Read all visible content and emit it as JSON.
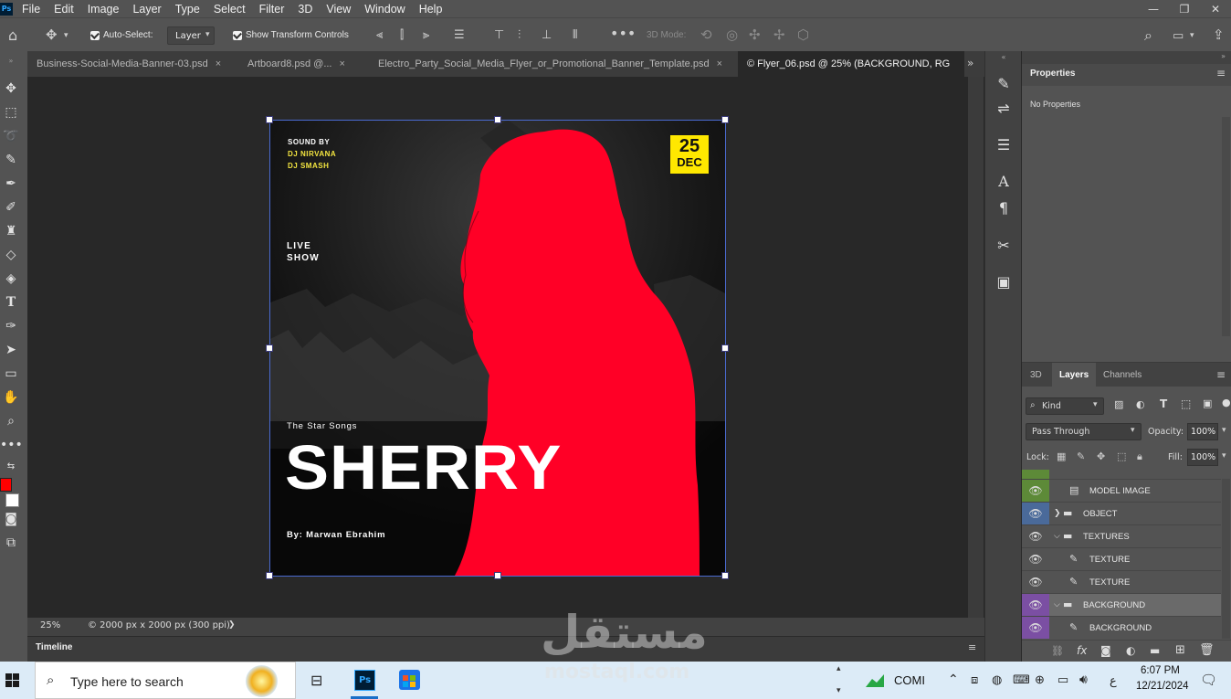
{
  "menu": [
    "File",
    "Edit",
    "Image",
    "Layer",
    "Type",
    "Select",
    "Filter",
    "3D",
    "View",
    "Window",
    "Help"
  ],
  "options": {
    "auto_select_label": "Auto-Select:",
    "auto_select_value": "Layer",
    "transform_label": "Show Transform Controls",
    "mode_3d_label": "3D Mode:"
  },
  "tabs": [
    {
      "label": "Business-Social-Media-Banner-03.psd",
      "close": "×"
    },
    {
      "label": "Artboard8.psd @...",
      "close": "×"
    },
    {
      "label": "Electro_Party_Social_Media_Flyer_or_Promotional_Banner_Template.psd",
      "close": "×"
    },
    {
      "label": "© Flyer_06.psd @ 25% (BACKGROUND, RG"
    }
  ],
  "tabs_more": "»",
  "poster": {
    "sound_by": "SOUND BY",
    "dj1": "DJ NIRVANA",
    "dj2": "DJ SMASH",
    "day": "25",
    "month": "DEC",
    "live": "LIVE",
    "show": "SHOW",
    "star_songs": "The Star Songs",
    "name": "SHERRY",
    "author": "By: Marwan Ebrahim"
  },
  "status": {
    "zoom": "25%",
    "doc_info": "© 2000 px x 2000 px (300 ppi)",
    "arrow": "❯"
  },
  "timeline_label": "Timeline",
  "properties": {
    "title": "Properties",
    "content": "No Properties"
  },
  "layers_panel": {
    "tabs": [
      "3D",
      "Layers",
      "Channels"
    ],
    "filter_kind": "Kind",
    "blend_mode": "Pass Through",
    "opacity_label": "Opacity:",
    "opacity_value": "100%",
    "lock_label": "Lock:",
    "fill_label": "Fill:",
    "fill_value": "100%",
    "rows": [
      {
        "name": "MODEL IMAGE",
        "color": "#5d8a38",
        "indent": 74,
        "icon": "▤"
      },
      {
        "name": "OBJECT",
        "color": "#4a6a9a",
        "indent": 67,
        "icon": "▬"
      },
      {
        "name": "TEXTURES",
        "color": "",
        "indent": 67,
        "icon": "▬"
      },
      {
        "name": "TEXTURE",
        "color": "",
        "indent": 74,
        "icon": "✎"
      },
      {
        "name": "TEXTURE",
        "color": "",
        "indent": 74,
        "icon": "✎"
      },
      {
        "name": "BACKGROUND",
        "color": "#7b4fa3",
        "indent": 67,
        "icon": "▬"
      },
      {
        "name": "BACKGROUND",
        "color": "#7b4fa3",
        "indent": 74,
        "icon": "✎"
      }
    ]
  },
  "taskbar": {
    "search_placeholder": "Type here to search",
    "app_label": "COMI",
    "lang": "ع",
    "time": "6:07 PM",
    "date": "12/21/2024"
  },
  "watermark": {
    "arabic": "مستقل",
    "latin": "mostaql.com"
  },
  "colors": {
    "accent_red": "#ff0026",
    "date_yellow": "#ffe800",
    "dj_yellow": "#f4e640"
  }
}
